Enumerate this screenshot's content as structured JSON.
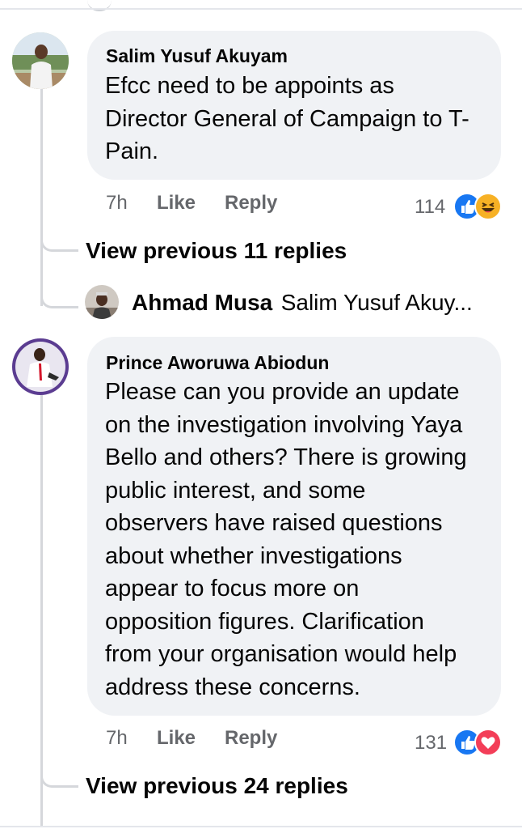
{
  "comments": [
    {
      "author": "Salim Yusuf Akuyam",
      "lines": [
        "Efcc need to be appoints as",
        "Director General of Campaign to T-",
        "Pain."
      ],
      "time": "7h",
      "like_label": "Like",
      "reply_label": "Reply",
      "reaction_count": "114",
      "reactions": [
        "like-reaction-icon",
        "haha-reaction-icon"
      ],
      "view_replies": "View previous 11 replies",
      "reply_preview": {
        "author": "Ahmad Musa",
        "text": "Salim Yusuf Akuy..."
      }
    },
    {
      "author": "Prince Aworuwa Abiodun",
      "lines": [
        "Please can you provide an update",
        "on the investigation involving Yaya",
        "Bello and others? There is growing",
        "public interest, and some",
        "observers have raised questions",
        "about whether investigations",
        "appear to focus more on",
        "opposition figures. Clarification",
        "from your organisation would help",
        "address these concerns."
      ],
      "time": "7h",
      "like_label": "Like",
      "reply_label": "Reply",
      "reaction_count": "131",
      "reactions": [
        "like-reaction-icon",
        "love-reaction-icon"
      ],
      "view_replies": "View previous 24 replies"
    }
  ],
  "colors": {
    "bubble": "#f0f2f5",
    "meta": "#65676b",
    "like_blue": "#1877f2",
    "love_red": "#f33e58",
    "haha_yellow": "#f7b125"
  }
}
